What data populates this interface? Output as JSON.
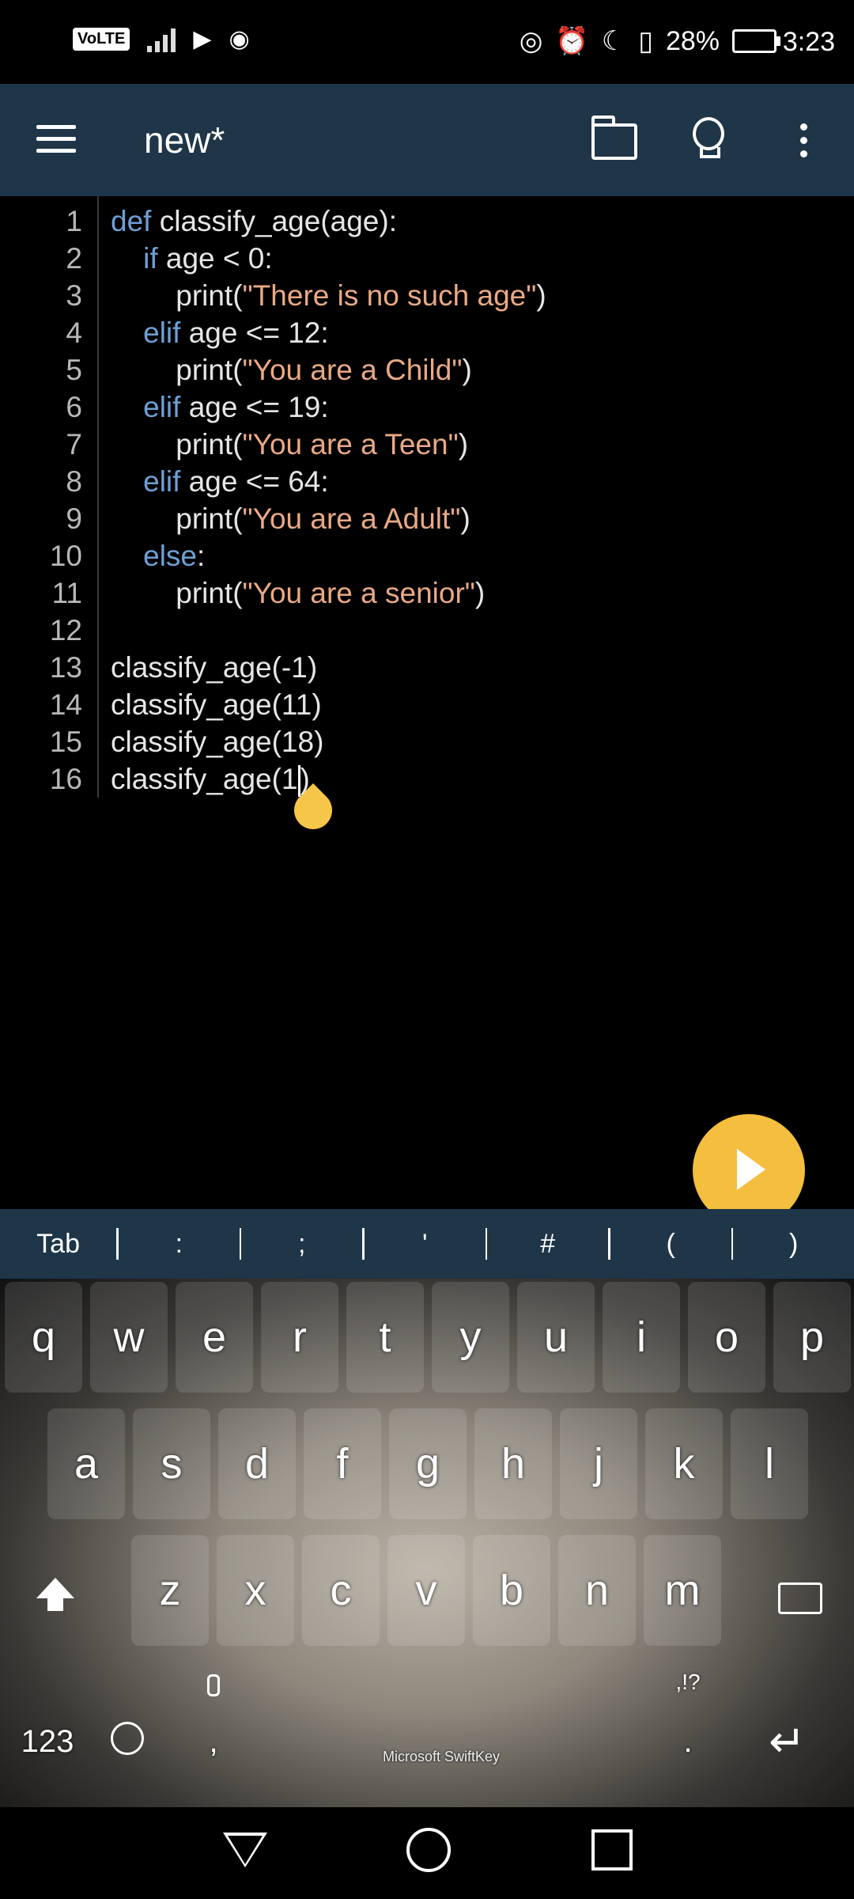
{
  "status": {
    "network_badge": "VoLTE",
    "battery": "28%",
    "time": "3:23"
  },
  "appbar": {
    "title": "new*",
    "icons": [
      "menu-icon",
      "folder-icon",
      "lightbulb-icon",
      "more-vert-icon"
    ]
  },
  "editor": {
    "lines": [
      {
        "n": "1",
        "parts": [
          [
            "kw",
            "def"
          ],
          [
            "p",
            " classify_age(age):"
          ]
        ]
      },
      {
        "n": "2",
        "parts": [
          [
            "p",
            "    "
          ],
          [
            "kw",
            "if"
          ],
          [
            "p",
            " age < 0:"
          ]
        ]
      },
      {
        "n": "3",
        "parts": [
          [
            "p",
            "        print("
          ],
          [
            "str",
            "\"There is no such age\""
          ],
          [
            "p",
            ")"
          ]
        ]
      },
      {
        "n": "4",
        "parts": [
          [
            "p",
            "    "
          ],
          [
            "kw",
            "elif"
          ],
          [
            "p",
            " age <= 12:"
          ]
        ]
      },
      {
        "n": "5",
        "parts": [
          [
            "p",
            "        print("
          ],
          [
            "str",
            "\"You are a Child\""
          ],
          [
            "p",
            ")"
          ]
        ]
      },
      {
        "n": "6",
        "parts": [
          [
            "p",
            "    "
          ],
          [
            "kw",
            "elif"
          ],
          [
            "p",
            " age <= 19:"
          ]
        ]
      },
      {
        "n": "7",
        "parts": [
          [
            "p",
            "        print("
          ],
          [
            "str",
            "\"You are a Teen\""
          ],
          [
            "p",
            ")"
          ]
        ]
      },
      {
        "n": "8",
        "parts": [
          [
            "p",
            "    "
          ],
          [
            "kw",
            "elif"
          ],
          [
            "p",
            " age <= 64:"
          ]
        ]
      },
      {
        "n": "9",
        "parts": [
          [
            "p",
            "        print("
          ],
          [
            "str",
            "\"You are a Adult\""
          ],
          [
            "p",
            ")"
          ]
        ]
      },
      {
        "n": "10",
        "parts": [
          [
            "p",
            "    "
          ],
          [
            "kw",
            "else"
          ],
          [
            "p",
            ":"
          ]
        ]
      },
      {
        "n": "11",
        "parts": [
          [
            "p",
            "        print("
          ],
          [
            "str",
            "\"You are a senior\""
          ],
          [
            "p",
            ")"
          ]
        ]
      },
      {
        "n": "12",
        "parts": []
      },
      {
        "n": "13",
        "parts": [
          [
            "p",
            "classify_age(-1)"
          ]
        ]
      },
      {
        "n": "14",
        "parts": [
          [
            "p",
            "classify_age(11)"
          ]
        ]
      },
      {
        "n": "15",
        "parts": [
          [
            "p",
            "classify_age(18)"
          ]
        ]
      },
      {
        "n": "16",
        "parts": [
          [
            "p",
            "classify_age(1"
          ],
          [
            "caret",
            ""
          ],
          [
            "p",
            ")"
          ]
        ]
      }
    ]
  },
  "symbols": [
    "Tab",
    ":",
    ";",
    "'",
    "#",
    "(",
    ")"
  ],
  "keyboard": {
    "row1": [
      "q",
      "w",
      "e",
      "r",
      "t",
      "y",
      "u",
      "i",
      "o",
      "p"
    ],
    "row2": [
      "a",
      "s",
      "d",
      "f",
      "g",
      "h",
      "j",
      "k",
      "l"
    ],
    "row3": [
      "z",
      "x",
      "c",
      "v",
      "b",
      "n",
      "m"
    ],
    "numbers_key": "123",
    "comma_key": ",",
    "punct_key": ".",
    "punct_hint": ",!?",
    "brand": "Microsoft SwiftKey"
  }
}
